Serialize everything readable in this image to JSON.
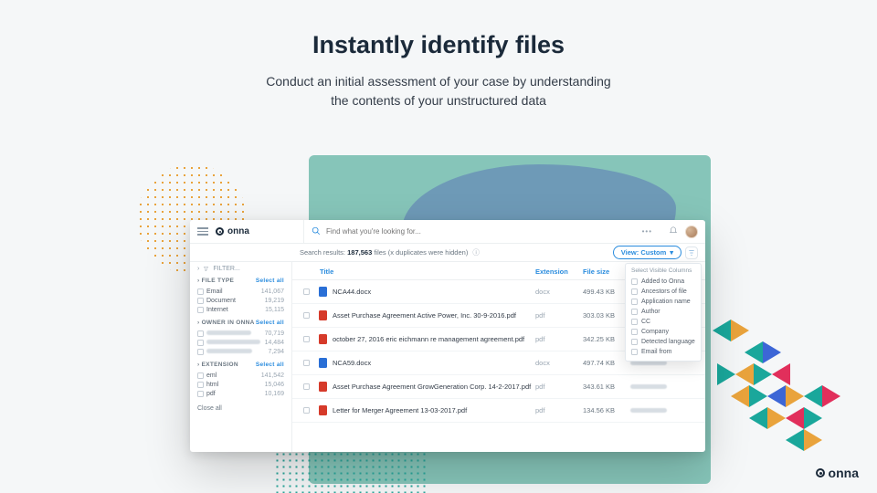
{
  "hero": {
    "title": "Instantly identify files",
    "subtitle_l1": "Conduct an initial assessment of your case by understanding",
    "subtitle_l2": "the contents of your unstructured data"
  },
  "brand": "onna",
  "search": {
    "placeholder": "Find what you're looking for..."
  },
  "results_bar": {
    "prefix": "Search results:",
    "count": "187,563",
    "suffix": "files (x duplicates were hidden)"
  },
  "view_button": "View: Custom",
  "sidebar": {
    "filter_label": "FILTER...",
    "sections": [
      {
        "title": "FILE TYPE",
        "select_all": "Select all",
        "items": [
          {
            "label": "Email",
            "count": "141,067"
          },
          {
            "label": "Document",
            "count": "19,219"
          },
          {
            "label": "Internet",
            "count": "15,115"
          }
        ]
      },
      {
        "title": "OWNER IN ONNA",
        "select_all": "Select all",
        "items": [
          {
            "label": "",
            "count": "70,719"
          },
          {
            "label": "",
            "count": "14,484"
          },
          {
            "label": "",
            "count": "7,294"
          }
        ]
      },
      {
        "title": "EXTENSION",
        "select_all": "Select all",
        "items": [
          {
            "label": "eml",
            "count": "141,542"
          },
          {
            "label": "html",
            "count": "15,046"
          },
          {
            "label": "pdf",
            "count": "10,169"
          }
        ]
      }
    ],
    "close_all": "Close all"
  },
  "table": {
    "headers": {
      "title": "Title",
      "ext": "Extension",
      "size": "File size"
    },
    "rows": [
      {
        "icon": "docx",
        "name": "NCA44.docx",
        "ext": "docx",
        "size": "499.43 KB"
      },
      {
        "icon": "pdf",
        "name": "Asset Purchase Agreement Active Power, Inc. 30-9-2016.pdf",
        "ext": "pdf",
        "size": "303.03 KB"
      },
      {
        "icon": "pdf",
        "name": "october 27, 2016 eric eichmann re management agreement.pdf",
        "ext": "pdf",
        "size": "342.25 KB"
      },
      {
        "icon": "docx",
        "name": "NCA59.docx",
        "ext": "docx",
        "size": "497.74 KB"
      },
      {
        "icon": "pdf",
        "name": "Asset Purchase Agreement GrowGeneration Corp. 14-2-2017.pdf",
        "ext": "pdf",
        "size": "343.61 KB"
      },
      {
        "icon": "pdf",
        "name": "Letter for Merger Agreement 13-03-2017.pdf",
        "ext": "pdf",
        "size": "134.56 KB"
      }
    ]
  },
  "popover": {
    "heading": "Select Visible Columns",
    "items": [
      {
        "label": "Added to Onna",
        "checked": false
      },
      {
        "label": "Ancestors of file",
        "checked": false
      },
      {
        "label": "Application name",
        "checked": false
      },
      {
        "label": "Author",
        "checked": false
      },
      {
        "label": "CC",
        "checked": false
      },
      {
        "label": "Company",
        "checked": false
      },
      {
        "label": "Detected language",
        "checked": false
      },
      {
        "label": "Email from",
        "checked": false
      }
    ]
  }
}
